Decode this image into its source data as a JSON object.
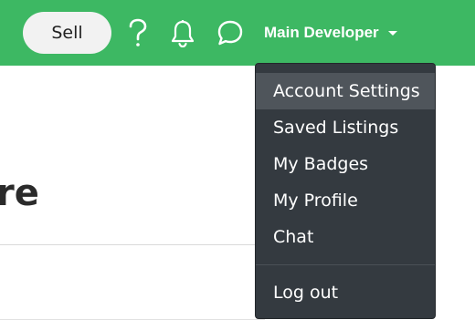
{
  "header": {
    "sell_label": "Sell",
    "help_icon": "question-mark-icon",
    "notifications_icon": "bell-icon",
    "messages_icon": "chat-bubble-icon",
    "user_name": "Main Developer",
    "colors": {
      "bar": "#3db863",
      "sell_bg": "#f2f2f2"
    }
  },
  "main": {
    "heading_fragment": "re"
  },
  "dropdown": {
    "items": [
      {
        "label": "Account Settings",
        "active": true
      },
      {
        "label": "Saved Listings"
      },
      {
        "label": "My Badges"
      },
      {
        "label": "My Profile"
      },
      {
        "label": "Chat"
      }
    ],
    "logout_label": "Log out",
    "colors": {
      "bg": "#343a40",
      "active_bg": "#4f555b"
    }
  }
}
